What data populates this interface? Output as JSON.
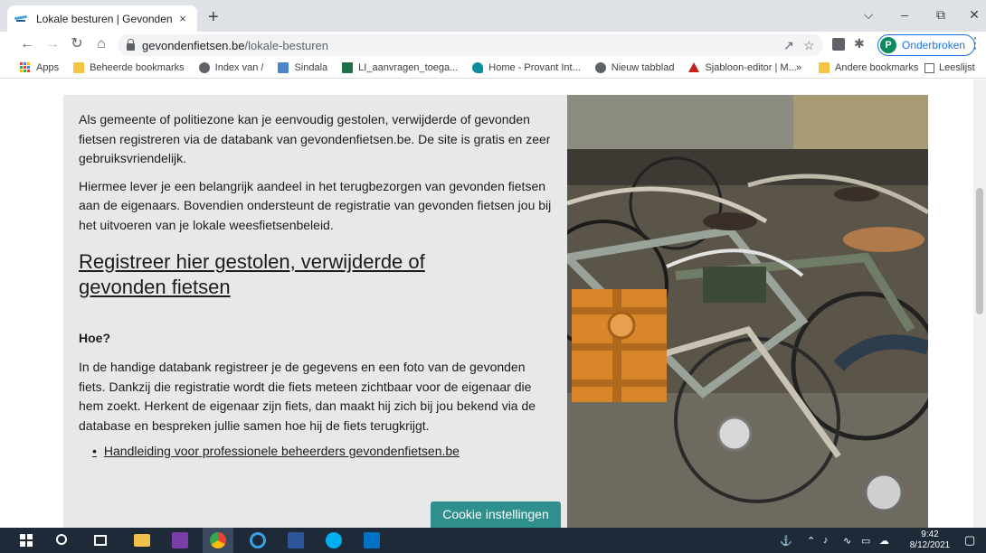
{
  "browser": {
    "tab_title": "Lokale besturen | Gevonden fiets",
    "tab_close": "×",
    "new_tab": "+",
    "url_host": "gevondenfietsen.be",
    "url_path": "/lokale-besturen",
    "profile_initial": "P",
    "profile_label": "Onderbroken"
  },
  "bookmarks": {
    "items": [
      {
        "label": "Apps",
        "icon": "apps-grid-icon"
      },
      {
        "label": "Beheerde bookmarks",
        "icon": "folder-icon"
      },
      {
        "label": "Index van /",
        "icon": "globe-icon"
      },
      {
        "label": "Sindala",
        "icon": "doc-icon"
      },
      {
        "label": "LI_aanvragen_toega...",
        "icon": "excel-icon"
      },
      {
        "label": "Home - Provant Int...",
        "icon": "provant-icon"
      },
      {
        "label": "Nieuw tabblad",
        "icon": "globe-icon"
      },
      {
        "label": "Sjabloon-editor | M...",
        "icon": "triangle-icon"
      }
    ],
    "overflow": "»",
    "other": "Andere bookmarks",
    "reading_list": "Leeslijst"
  },
  "content": {
    "para1": "Als gemeente of politiezone kan je eenvoudig gestolen, verwijderde of gevonden fietsen registreren via de databank van gevondenfietsen.be. De site is gratis en zeer gebruiksvriendelijk.",
    "para2": "Hiermee lever je een belangrijk aandeel in het terugbezorgen van gevonden fietsen aan de eigenaars. Bovendien ondersteunt de registratie van gevonden fietsen jou bij het uitvoeren van je lokale weesfietsenbeleid.",
    "heading_link": "Registreer hier gestolen, verwijderde of gevonden fietsen",
    "subheading": "Hoe?",
    "para3": "In de handige databank registreer je de gegevens en een foto van de gevonden fiets. Dankzij die registratie wordt die fiets meteen zichtbaar voor de eigenaar die hem zoekt. Herkent de eigenaar zijn fiets, dan maakt hij zich bij jou bekend via de database en bespreken jullie samen hoe hij de fiets terugkrijgt.",
    "list_link": "Handleiding voor professionele beheerders gevondenfietsen.be",
    "cookie_button": "Cookie instellingen"
  },
  "taskbar": {
    "time": "9:42",
    "date": "8/12/2021"
  }
}
